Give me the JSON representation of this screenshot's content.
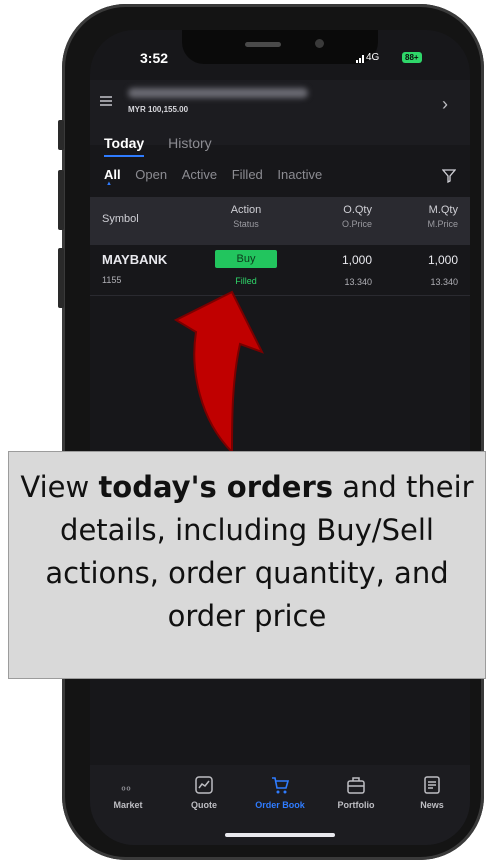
{
  "status_bar": {
    "time": "3:52",
    "network": "4G",
    "battery": "88+"
  },
  "header": {
    "balance": "MYR 100,155.00"
  },
  "tabs": [
    "Today",
    "History"
  ],
  "filters": [
    "All",
    "Open",
    "Active",
    "Filled",
    "Inactive"
  ],
  "table": {
    "headers": {
      "symbol": "Symbol",
      "action": "Action",
      "status": "Status",
      "oqty": "O.Qty",
      "oprice": "O.Price",
      "mqty": "M.Qty",
      "mprice": "M.Price"
    },
    "rows": [
      {
        "symbol": "MAYBANK",
        "code": "1155",
        "action": "Buy",
        "status": "Filled",
        "oqty": "1,000",
        "oprice": "13.340",
        "mqty": "1,000",
        "mprice": "13.340"
      }
    ]
  },
  "bottom_nav": [
    {
      "label": "Market",
      "icon": "market-icon"
    },
    {
      "label": "Quote",
      "icon": "quote-icon"
    },
    {
      "label": "Order Book",
      "icon": "cart-icon"
    },
    {
      "label": "Portfolio",
      "icon": "briefcase-icon"
    },
    {
      "label": "News",
      "icon": "news-icon"
    }
  ],
  "callout": {
    "part1": "View ",
    "bold": "today's orders",
    "part2": " and their details, including Buy/Sell actions, order quantity, and order price"
  },
  "colors": {
    "accent": "#2f7cff",
    "buy": "#22c55e",
    "filled": "#2fd76a",
    "screen_bg": "#17171a"
  }
}
